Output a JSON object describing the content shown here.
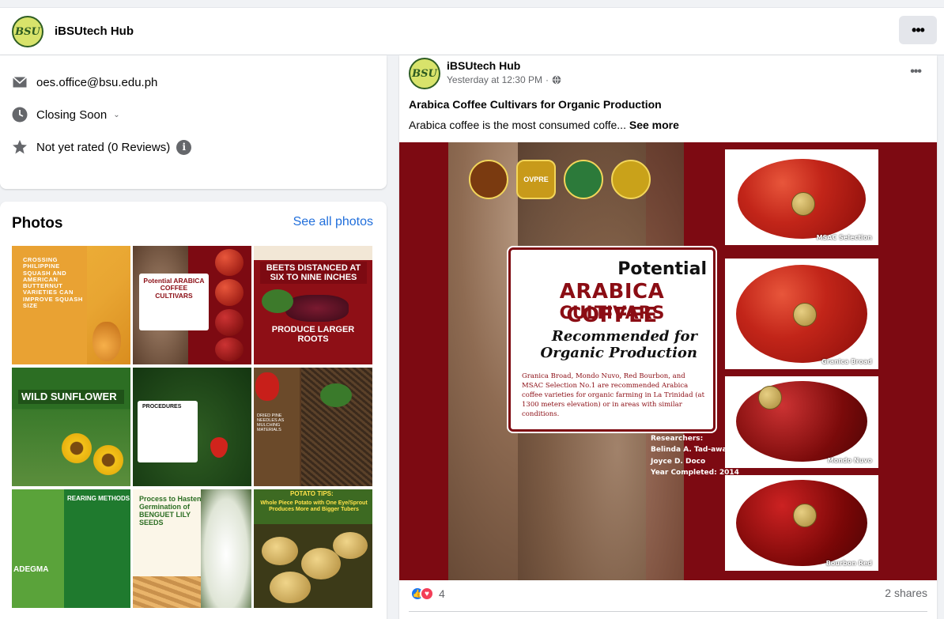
{
  "header": {
    "page_name": "iBSUtech Hub",
    "logo_text": "BSU",
    "more_label": "•••"
  },
  "intro": {
    "email": "oes.office@bsu.edu.ph",
    "hours_status": "Closing Soon",
    "rating": "Not yet rated (0 Reviews)",
    "info_icon": "i"
  },
  "photos": {
    "title": "Photos",
    "see_all": "See all photos",
    "thumbs": [
      {
        "caption": "CROSSING PHILIPPINE SQUASH AND AMERICAN BUTTERNUT VARIETIES CAN IMPROVE SQUASH SIZE"
      },
      {
        "caption": "Potential ARABICA COFFEE CULTIVARS"
      },
      {
        "caption": "BEETS DISTANCED AT SIX TO NINE INCHES",
        "caption2": "PRODUCE LARGER ROOTS"
      },
      {
        "caption": "WILD SUNFLOWER"
      },
      {
        "caption": "PROCEDURES"
      },
      {
        "caption": "DRIED PINE NEEDLES AS MULCHING MATERIALS"
      },
      {
        "caption": "REARING METHODS",
        "caption2": "ADEGMA"
      },
      {
        "caption": "Process to Hasten Germination of BENGUET LILY SEEDS"
      },
      {
        "caption": "POTATO TIPS:",
        "caption2": "Whole Piece Potato with One Eye/Sprout Produces More and Bigger Tubers"
      }
    ]
  },
  "post": {
    "author": "iBSUtech Hub",
    "time": "Yesterday at 12:30 PM",
    "title": "Arabica Coffee Cultivars for Organic Production",
    "text": "Arabica coffee is the most consumed coffe...",
    "see_more": "See more",
    "image": {
      "seal_label": "OVPRE",
      "potential": "Potential",
      "title1": "ARABICA COFFEE",
      "title2": "CULTIVARS",
      "recommended": "Recommended for",
      "organic": "Organic Production",
      "description": "Granica Broad, Mondo Nuvo, Red Bourbon, and MSAC Selection No.1 are recommended Arabica coffee varieties for organic farming in La Trinidad (at 1300 meters elevation) or in areas with similar conditions.",
      "researchers_label": "Researchers:",
      "researcher1": "Belinda A. Tad-awan",
      "researcher2": "Joyce D. Doco",
      "year": "Year Completed: 2014",
      "cultivars": [
        "MSAC Selection",
        "Granica Broad",
        "Mondo Nuvo",
        "Bourbon Red"
      ]
    },
    "reaction_count": "4",
    "shares": "2 shares"
  }
}
